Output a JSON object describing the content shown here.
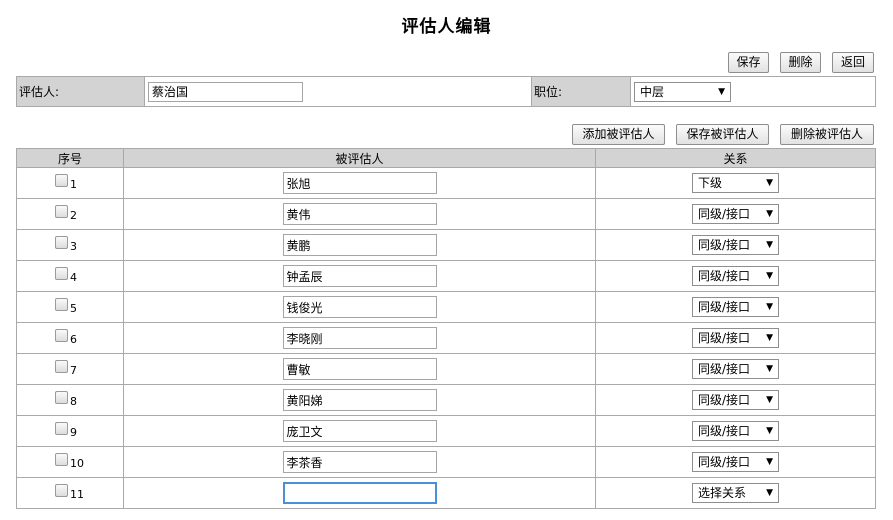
{
  "page": {
    "title": "评估人编辑"
  },
  "toolbar": {
    "save": "保存",
    "delete": "删除",
    "back": "返回"
  },
  "assessor": {
    "label": "评估人:",
    "value": "蔡治国",
    "position_label": "职位:",
    "position_value": "中层"
  },
  "actions": {
    "add": "添加被评估人",
    "save": "保存被评估人",
    "delete": "删除被评估人"
  },
  "table": {
    "headers": {
      "seq": "序号",
      "name": "被评估人",
      "relation": "关系"
    },
    "rows": [
      {
        "seq": "1",
        "name": "张旭",
        "relation": "下级"
      },
      {
        "seq": "2",
        "name": "黄伟",
        "relation": "同级/接口"
      },
      {
        "seq": "3",
        "name": "黄鹏",
        "relation": "同级/接口"
      },
      {
        "seq": "4",
        "name": "钟孟辰",
        "relation": "同级/接口"
      },
      {
        "seq": "5",
        "name": "钱俊光",
        "relation": "同级/接口"
      },
      {
        "seq": "6",
        "name": "李晓刚",
        "relation": "同级/接口"
      },
      {
        "seq": "7",
        "name": "曹敏",
        "relation": "同级/接口"
      },
      {
        "seq": "8",
        "name": "黄阳娣",
        "relation": "同级/接口"
      },
      {
        "seq": "9",
        "name": "庞卫文",
        "relation": "同级/接口"
      },
      {
        "seq": "10",
        "name": "李茶香",
        "relation": "同级/接口"
      },
      {
        "seq": "11",
        "name": "",
        "relation": "选择关系"
      }
    ]
  },
  "icons": {
    "dropdown": "dropdown-arrow-icon",
    "checkbox": "checkbox-icon"
  }
}
